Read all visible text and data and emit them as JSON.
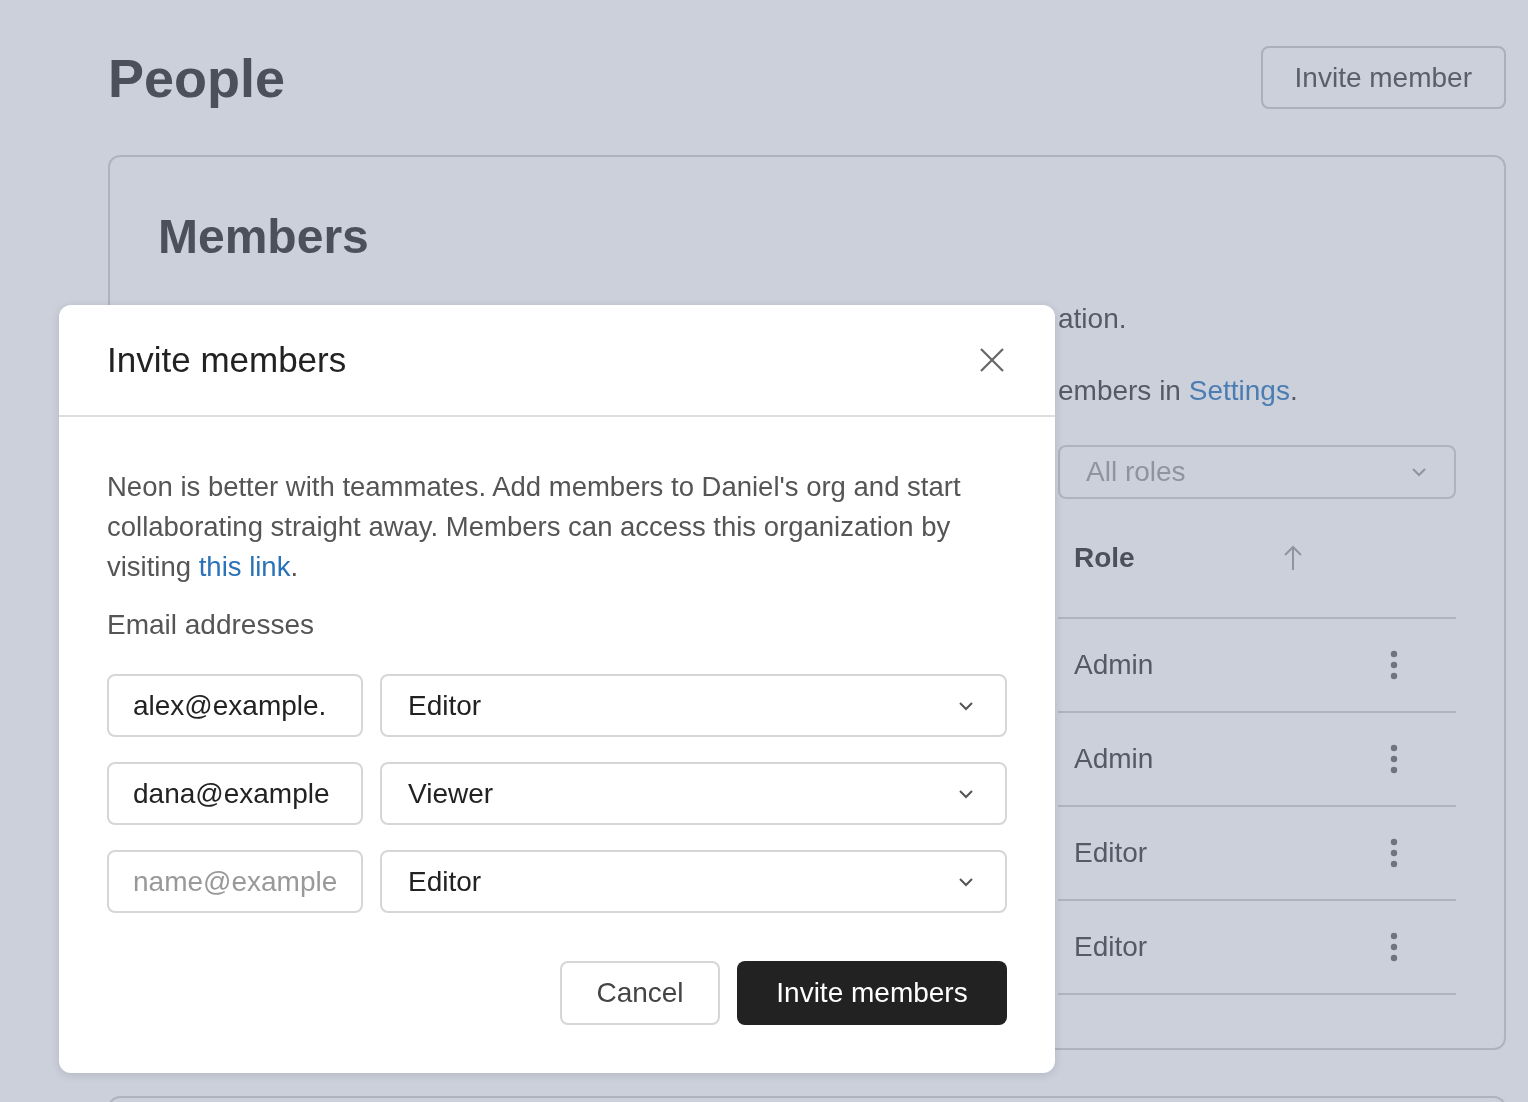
{
  "page": {
    "title": "People",
    "invite_button": "Invite member"
  },
  "members_card": {
    "title": "Members",
    "line_1": "ation.",
    "line_2": {
      "text": "embers in ",
      "link": "Settings",
      "after": "."
    },
    "role_filter": "All roles",
    "column_header": "Role",
    "rows": [
      {
        "role": "Admin"
      },
      {
        "role": "Admin"
      },
      {
        "role": "Editor"
      },
      {
        "role": "Editor"
      }
    ]
  },
  "modal": {
    "title": "Invite members",
    "description": "Neon is better with teammates. Add members to Daniel's org and start collaborating straight away. Members can access this organization by visiting ",
    "link": "this link",
    "after": ".",
    "email_label": "Email addresses",
    "invites": [
      {
        "value": "alex@example.",
        "role": "Editor"
      },
      {
        "value": "dana@example",
        "role": "Viewer"
      },
      {
        "placeholder": "name@example",
        "role": "Editor"
      }
    ],
    "buttons": [
      {
        "label": "Cancel",
        "kind": "secondary"
      },
      {
        "label": "Invite members",
        "kind": "primary"
      }
    ]
  }
}
